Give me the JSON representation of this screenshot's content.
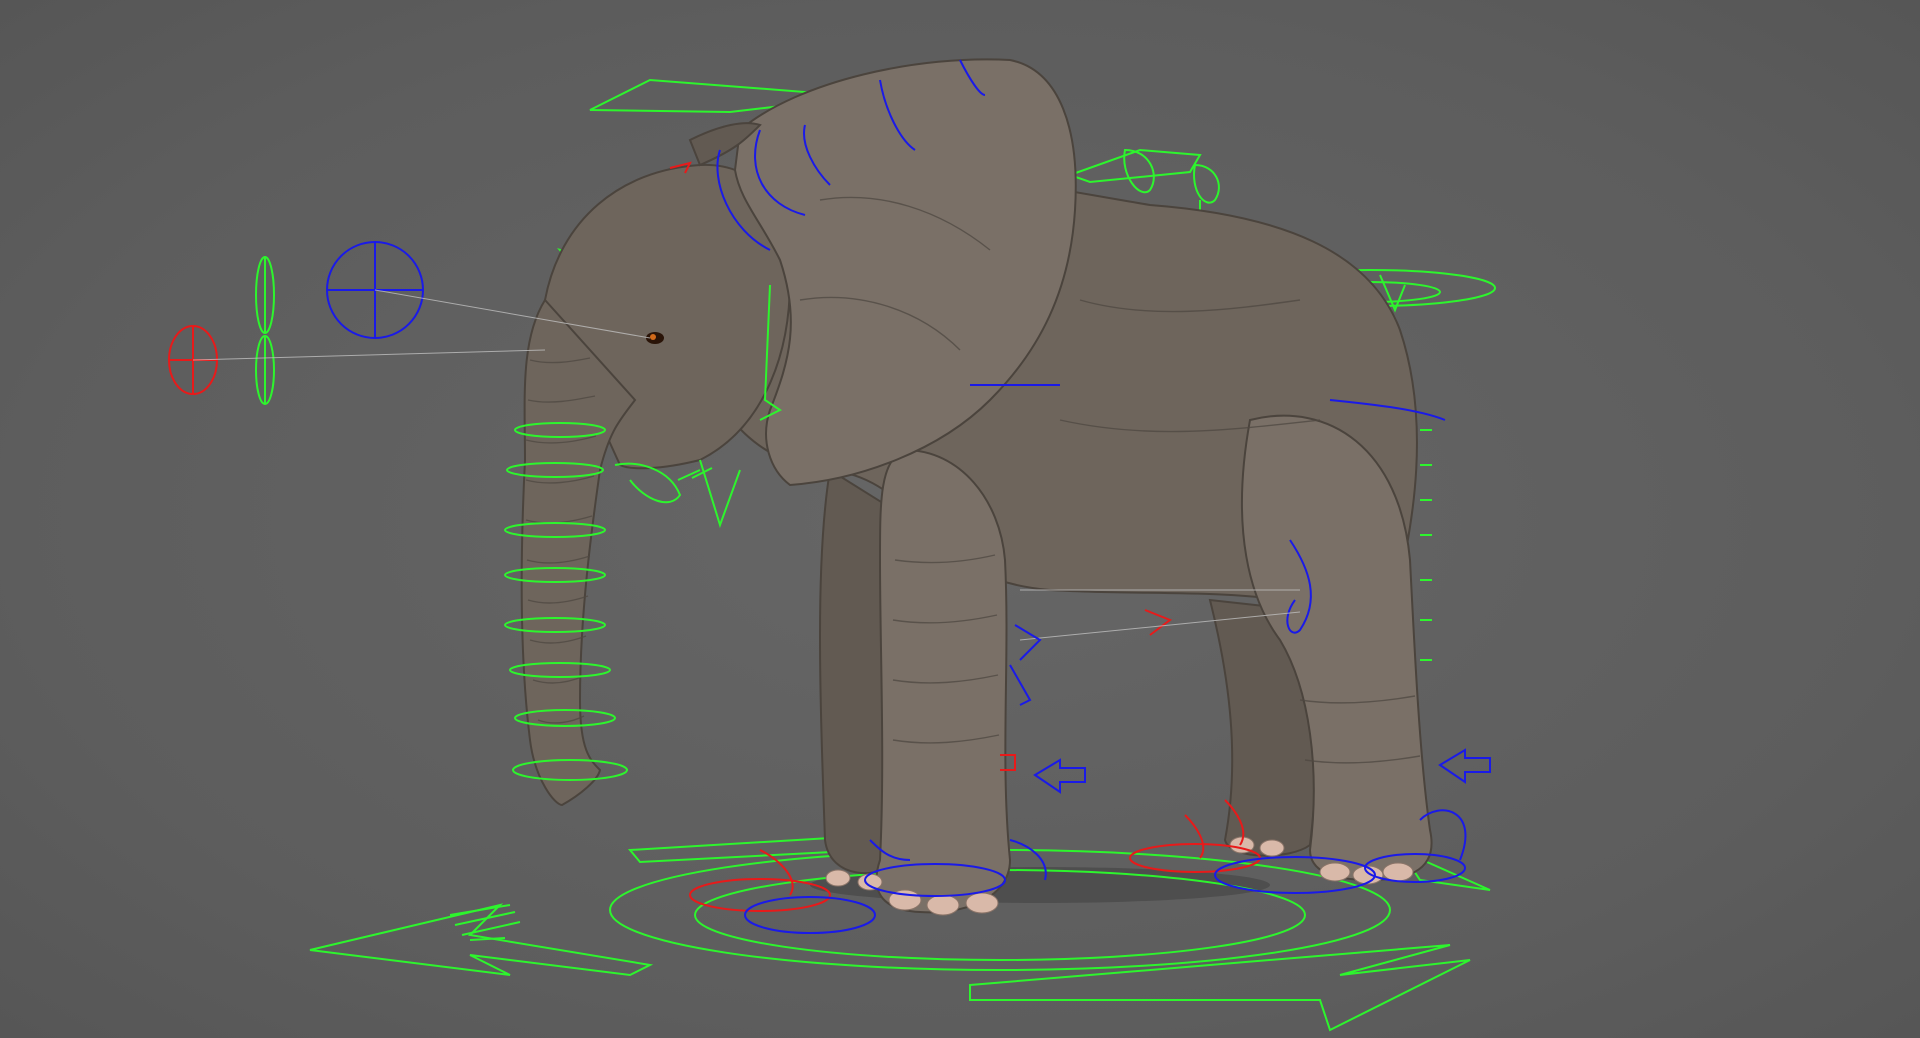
{
  "viewport": {
    "background_color": "#5f5f5f",
    "subject": "elephant-rig",
    "control_colors": {
      "left_side": "#1a1ae8",
      "right_side": "#e81a1a",
      "center": "#2df52d"
    }
  }
}
